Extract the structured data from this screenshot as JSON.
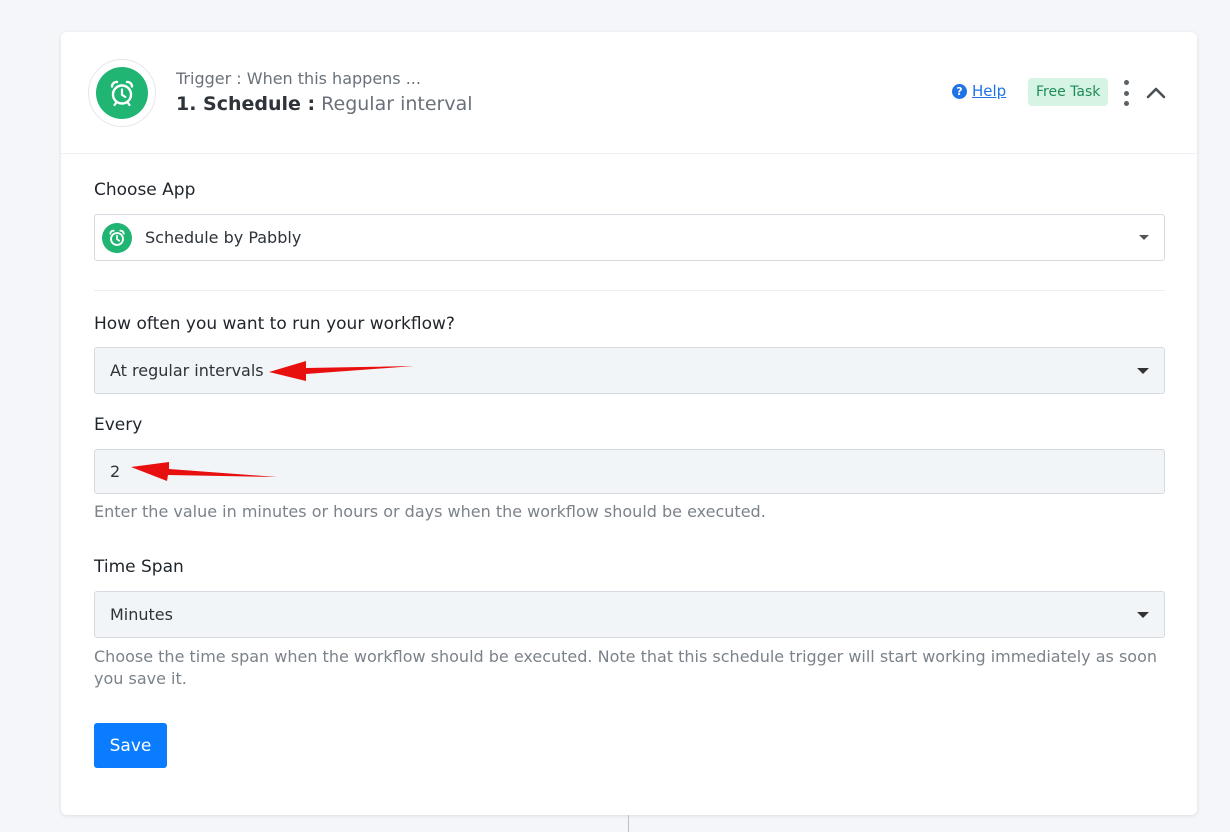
{
  "header": {
    "trigger_label": "Trigger : When this happens ...",
    "step_number_app": "1. Schedule :",
    "step_event": "Regular interval",
    "help_label": "Help",
    "free_task_label": "Free Task"
  },
  "choose_app": {
    "label": "Choose App",
    "selected": "Schedule by Pabbly"
  },
  "frequency": {
    "label": "How often you want to run your workflow?",
    "selected": "At regular intervals"
  },
  "every": {
    "label": "Every",
    "value": "2",
    "hint": "Enter the value in minutes or hours or days when the workflow should be executed."
  },
  "time_span": {
    "label": "Time Span",
    "selected": "Minutes",
    "hint": "Choose the time span when the workflow should be executed. Note that this schedule trigger will start working immediately as soon you save it."
  },
  "save_label": "Save",
  "colors": {
    "accent": "#0a7cff",
    "app_green": "#21b573",
    "badge_bg": "#d6f4e3",
    "annotation_red": "#e8100f"
  },
  "icons": {
    "app_logo": "alarm-clock-icon",
    "help": "question-circle-icon",
    "menu": "kebab-menu-icon",
    "collapse": "chevron-up-icon",
    "annotation": "red-arrow-icon"
  }
}
